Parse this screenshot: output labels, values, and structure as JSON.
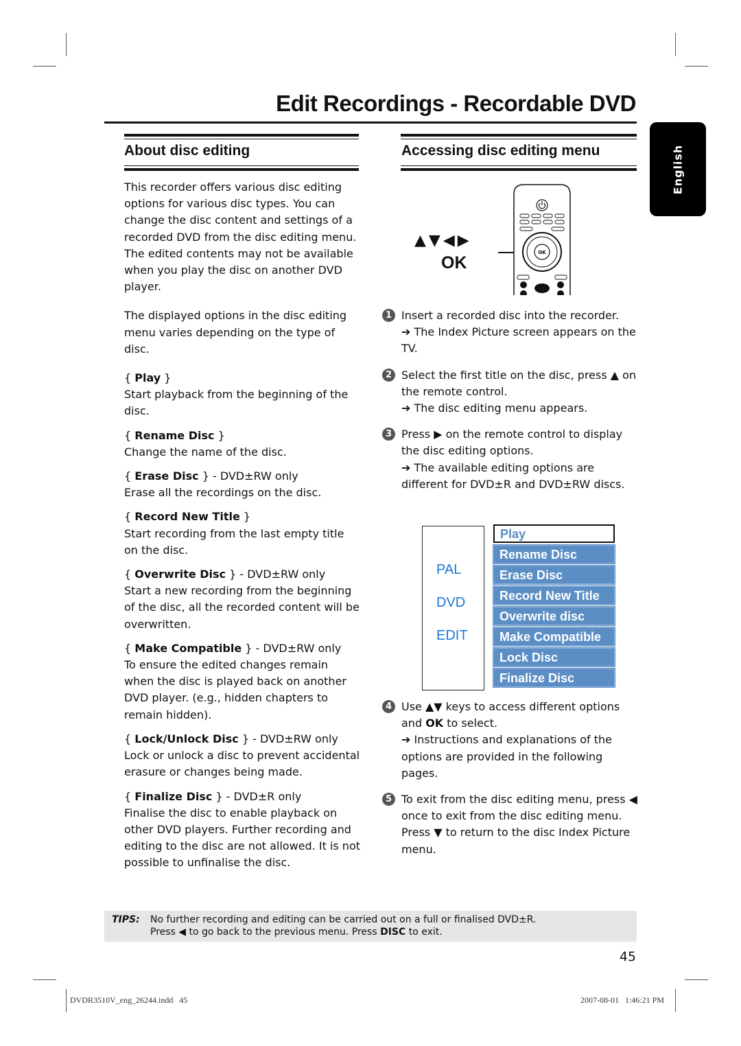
{
  "page": {
    "title": "Edit Recordings - Recordable DVD",
    "language_tab": "English",
    "page_number": "45"
  },
  "left": {
    "heading": "About disc editing",
    "intro_paragraphs": [
      "This recorder offers various disc editing options for various disc types. You can change the disc content and settings of a recorded DVD from the disc editing menu. The edited contents may not be available when you play the disc on another DVD player.",
      "The displayed options in the disc editing menu varies depending on the type of disc."
    ],
    "options": [
      {
        "name": "Play",
        "suffix": "",
        "description": "Start playback from the beginning of the disc."
      },
      {
        "name": "Rename Disc",
        "suffix": "",
        "description": "Change the name of the disc."
      },
      {
        "name": "Erase Disc",
        "suffix": " - DVD±RW only",
        "description": "Erase all the recordings on the disc."
      },
      {
        "name": "Record New Title",
        "suffix": "",
        "description": "Start recording from the last empty title on the disc."
      },
      {
        "name": "Overwrite Disc",
        "suffix": " - DVD±RW only",
        "description": "Start a new recording from the beginning of the disc, all the recorded content will be overwritten."
      },
      {
        "name": "Make Compatible",
        "suffix": " - DVD±RW only",
        "description": "To ensure the edited changes remain when the disc is played back on another DVD player. (e.g., hidden chapters to remain hidden)."
      },
      {
        "name": "Lock/Unlock Disc",
        "suffix": " - DVD±RW only",
        "description": "Lock or unlock a disc to prevent accidental erasure or changes being made."
      },
      {
        "name": "Finalize Disc",
        "suffix": " - DVD±R only",
        "description": "Finalise the disc to enable playback on other DVD players. Further recording and editing to the disc are not allowed. It is not possible to unfinalise the disc."
      }
    ]
  },
  "right": {
    "heading": "Accessing disc editing menu",
    "remote": {
      "arrow_keys": "▲▼◀▶",
      "ok_label": "OK",
      "center_button": "OK"
    },
    "steps": [
      {
        "num": "1",
        "text": "Insert a recorded disc into the recorder.",
        "result": "➔ The Index Picture screen appears on the TV."
      },
      {
        "num": "2",
        "text": "Select the first title on the disc, press ▲ on the remote control.",
        "result": "➔ The disc editing menu appears."
      },
      {
        "num": "3",
        "text": "Press ▶ on the remote control to display the disc editing options.",
        "result": "➔ The available editing options are different for DVD±R and DVD±RW discs."
      },
      {
        "num": "4",
        "text_pre": "Use ▲▼ keys to access different options and ",
        "text_bold": "OK",
        "text_post": " to select.",
        "result": "➔ Instructions and explanations of the options are provided in the following pages."
      },
      {
        "num": "5",
        "text": "To exit from the disc editing menu, press ◀ once to exit from the disc editing menu.  Press ▼ to return to the disc Index Picture menu.",
        "result": ""
      }
    ],
    "menu": {
      "left_labels": [
        "PAL",
        "DVD",
        "EDIT"
      ],
      "items": [
        "Play",
        "Rename Disc",
        "Erase Disc",
        "Record New Title",
        "Overwrite disc",
        "Make Compatible",
        "Lock Disc",
        "Finalize Disc"
      ],
      "selected": "Play",
      "colors": {
        "item_bg": "#5b8ec5",
        "label_blue": "#1a75d8"
      }
    }
  },
  "tips": {
    "label": "TIPS:",
    "line1": "No further recording and editing can be carried out on a full or finalised DVD±R.",
    "line2_pre": "Press ◀ to go back to the previous menu. Press ",
    "line2_bold": "DISC",
    "line2_post": " to exit."
  },
  "footer": {
    "file": "DVDR3510V_eng_26244.indd   45",
    "timestamp": "2007-08-01   1:46:21 PM"
  }
}
